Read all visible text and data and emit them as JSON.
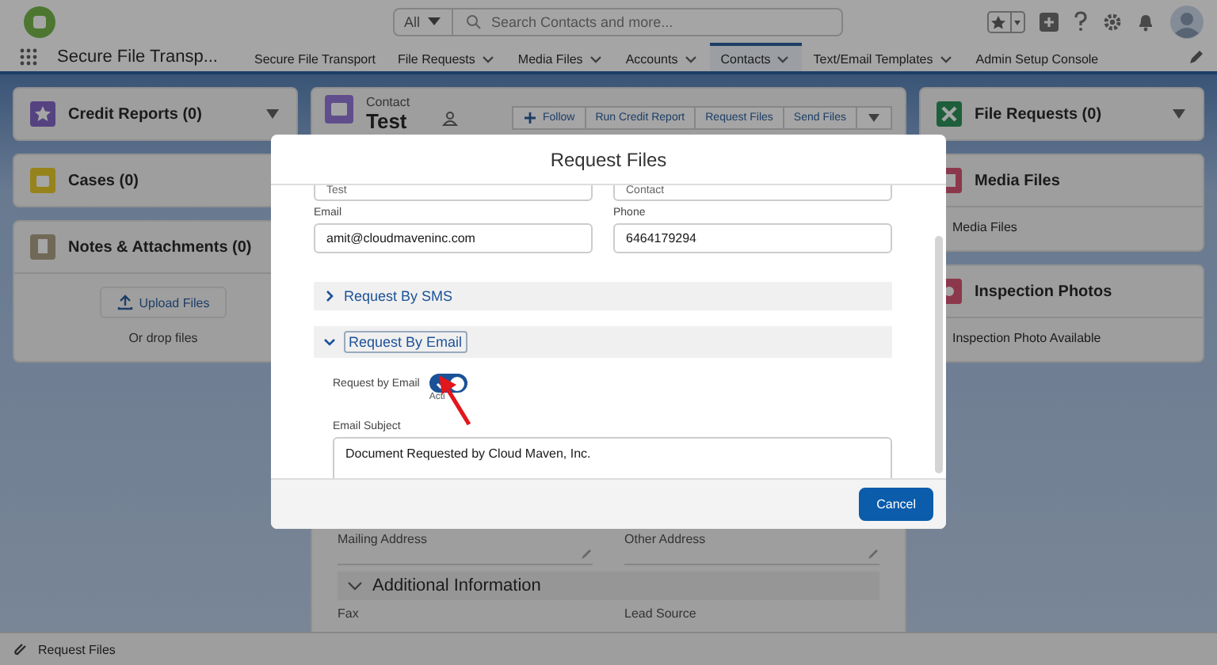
{
  "header": {
    "search_scope": "All",
    "search_placeholder": "Search Contacts and more..."
  },
  "nav": {
    "app_name": "Secure File Transp...",
    "items": [
      {
        "label": "Secure File Transport",
        "dropdown": false,
        "selected": false
      },
      {
        "label": "File Requests",
        "dropdown": true,
        "selected": false
      },
      {
        "label": "Media Files",
        "dropdown": true,
        "selected": false
      },
      {
        "label": "Accounts",
        "dropdown": true,
        "selected": false
      },
      {
        "label": "Contacts",
        "dropdown": true,
        "selected": true
      },
      {
        "label": "Text/Email Templates",
        "dropdown": true,
        "selected": false
      },
      {
        "label": "Admin Setup Console",
        "dropdown": false,
        "selected": false
      }
    ]
  },
  "left_cards": [
    {
      "kind": "credit",
      "title": "Credit Reports (0)"
    },
    {
      "kind": "cases",
      "title": "Cases (0)"
    },
    {
      "kind": "notes",
      "title": "Notes & Attachments (0)",
      "upload_button": "Upload Files",
      "drop_hint": "Or drop files"
    }
  ],
  "contact": {
    "object_label": "Contact",
    "name": "Test",
    "actions": [
      "Follow",
      "Run Credit Report",
      "Request Files",
      "Send Files"
    ]
  },
  "details": {
    "fields": [
      "Mailing Address",
      "Other Address"
    ],
    "section": {
      "title": "Additional Information",
      "expanded": true
    },
    "more_fields": [
      "Fax",
      "Lead Source"
    ]
  },
  "right_cards": [
    {
      "kind": "requests",
      "title": "File Requests (0)"
    },
    {
      "kind": "media",
      "title": "Media Files",
      "body": "Media Files"
    },
    {
      "kind": "photos",
      "title": "Inspection Photos",
      "body": "Inspection Photo Available"
    }
  ],
  "modal": {
    "title": "Request Files",
    "top_fields": [
      "Test",
      "Contact"
    ],
    "fields": [
      {
        "label": "Email",
        "value": "amit@cloudmaveninc.com"
      },
      {
        "label": "Phone",
        "value": "6464179294"
      }
    ],
    "sections": [
      {
        "title": "Request By SMS",
        "expanded": false
      },
      {
        "title": "Request By Email",
        "expanded": true
      }
    ],
    "toggle": {
      "label": "Request by Email",
      "on": true,
      "state_text": "Acti"
    },
    "subject": {
      "label": "Email Subject",
      "value": "Document Requested by Cloud Maven, Inc."
    },
    "buttons": [
      "Cancel"
    ]
  },
  "utility_bar": {
    "item": "Request Files"
  }
}
